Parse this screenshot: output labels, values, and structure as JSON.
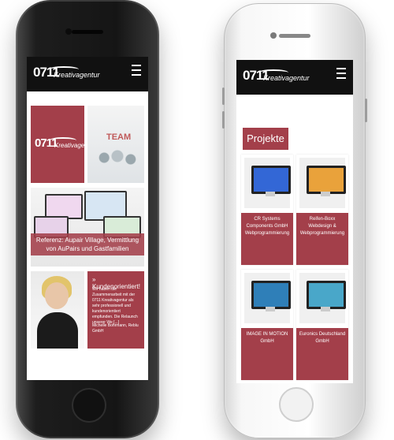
{
  "left_phone": {
    "header": {
      "logo": "0711",
      "logo_sub": "Kreativagentur"
    },
    "tile_logo": {
      "logo": "0711",
      "logo_sub": "Kreativagentur"
    },
    "team_label": "TEAM",
    "laptop_caption": "Referenz: Aupair Village, Vermittlung von AuPairs und Gastfamilien",
    "testimonial": {
      "title": "» Kundenorientiert!",
      "body": "Wir haben die Zusammenarbeit mit der 0711 Kreativagentur als sehr professionell und kundenorientiert empfunden. Die Relaunch unserer We [...]",
      "author": "Michelle Bohrmann, Reblu GmbH"
    }
  },
  "right_phone": {
    "header": {
      "logo": "0711",
      "logo_sub": "Kreativagentur"
    },
    "section_title": "Projekte",
    "projects": [
      {
        "name": "CR Systems Components GmbH",
        "type": "Webprogrammierung"
      },
      {
        "name": "Reifen-Boxx",
        "type": "Webdesign & Webprogrammierung"
      },
      {
        "name": "IMAGE IN MOTION",
        "type": "GmbH"
      },
      {
        "name": "Euronics Deutschland",
        "type": "GmbH"
      }
    ]
  },
  "colors": {
    "brand_red": "#a33f4a",
    "header_black": "#111111"
  }
}
